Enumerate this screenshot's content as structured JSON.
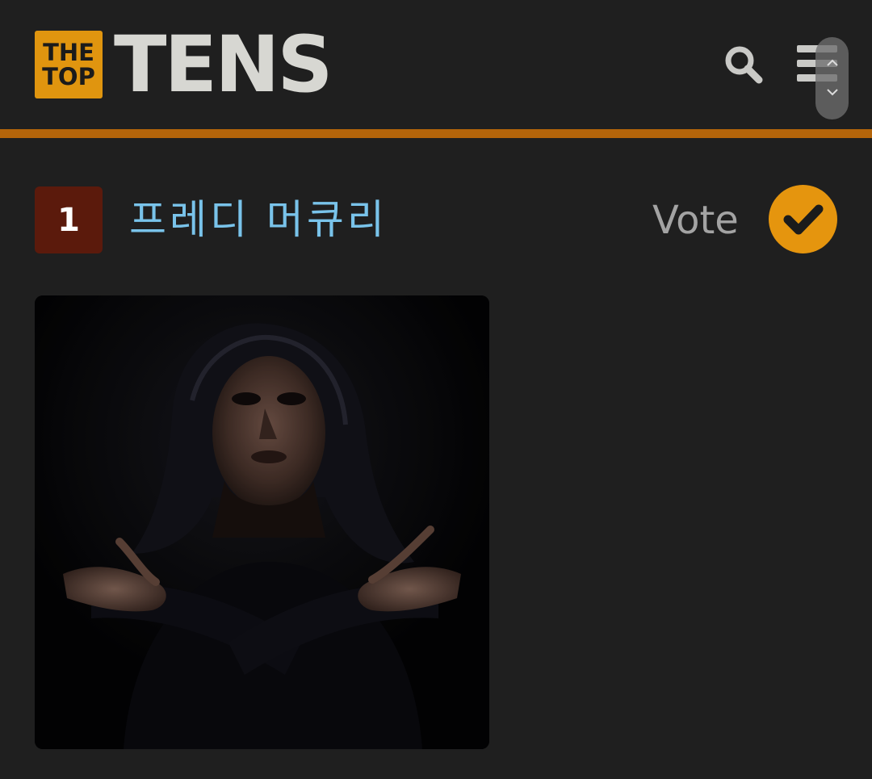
{
  "header": {
    "logo_badge_line1": "THE",
    "logo_badge_line2": "TOP",
    "logo_word": "TENS",
    "search_icon": "search-icon",
    "menu_icon": "hamburger-menu-icon",
    "scroll_up_icon": "chevron-up-icon",
    "scroll_down_icon": "chevron-down-icon"
  },
  "item": {
    "rank": "1",
    "title": "프레디 머큐리",
    "vote_label": "Vote",
    "vote_icon": "checkmark-icon",
    "image_subject": "portrait-photo"
  },
  "colors": {
    "background": "#1f1f1f",
    "accent_rule": "#b4650a",
    "logo_badge": "#e0950f",
    "logo_word": "#d7d7d2",
    "rank_badge": "#5b1a0c",
    "title_link": "#79c3ea",
    "vote_text": "#a3a3a3",
    "vote_button": "#e5950e"
  }
}
